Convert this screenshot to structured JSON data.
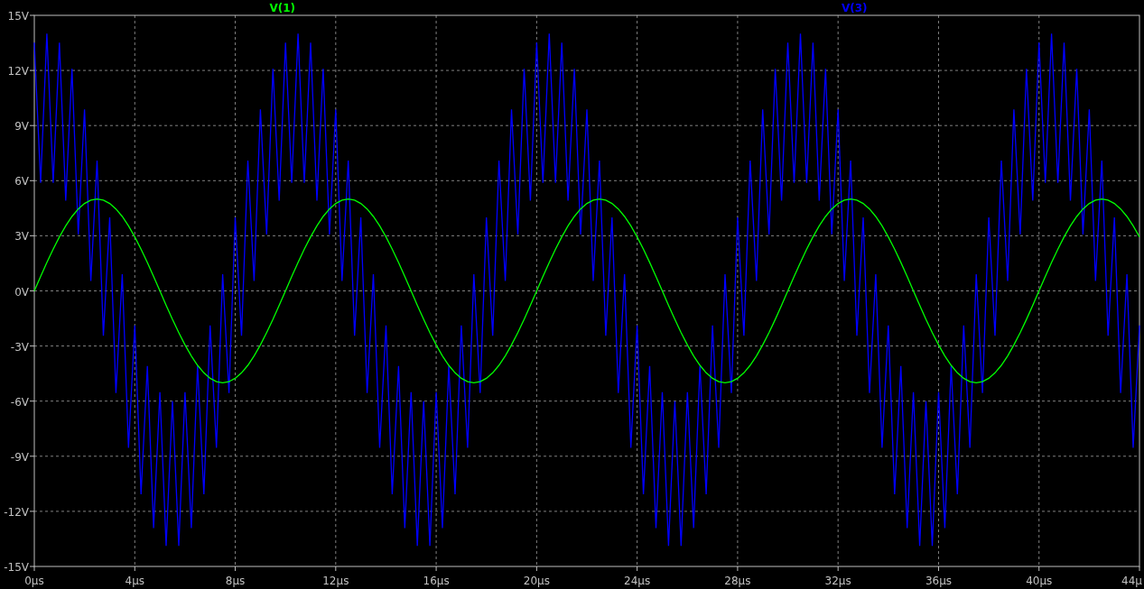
{
  "plot": {
    "chart_data": {
      "type": "line",
      "x": [
        0,
        0.25,
        0.5,
        0.75,
        1,
        1.25,
        1.5,
        1.75,
        2,
        2.25,
        2.5,
        2.75,
        3,
        3.25,
        3.5,
        3.75,
        4,
        4.25,
        4.5,
        4.75,
        5,
        5.25,
        5.5,
        5.75,
        6,
        6.25,
        6.5,
        6.75,
        7,
        7.25,
        7.5,
        7.75,
        8,
        8.25,
        8.5,
        8.75,
        9,
        9.25,
        9.5,
        9.75,
        10,
        10.25,
        10.5,
        10.75,
        11,
        11.25,
        11.5,
        11.75,
        12,
        12.25,
        12.5,
        12.75,
        13,
        13.25,
        13.5,
        13.75,
        14,
        14.25,
        14.5,
        14.75,
        15,
        15.25,
        15.5,
        15.75,
        16,
        16.25,
        16.5,
        16.75,
        17,
        17.25,
        17.5,
        17.75,
        18,
        18.25,
        18.5,
        18.75,
        19,
        19.25,
        19.5,
        19.75,
        20,
        20.25,
        20.5,
        20.75,
        21,
        21.25,
        21.5,
        21.75,
        22,
        22.25,
        22.5,
        22.75,
        23,
        23.25,
        23.5,
        23.75,
        24,
        24.25,
        24.5,
        24.75,
        25,
        25.25,
        25.5,
        25.75,
        26,
        26.25,
        26.5,
        26.75,
        27,
        27.25,
        27.5,
        27.75,
        28,
        28.25,
        28.5,
        28.75,
        29,
        29.25,
        29.5,
        29.75,
        30,
        30.25,
        30.5,
        30.75,
        31,
        31.25,
        31.5,
        31.75,
        32,
        32.25,
        32.5,
        32.75,
        33,
        33.25,
        33.5,
        33.75,
        34,
        34.25,
        34.5,
        34.75,
        35,
        35.25,
        35.5,
        35.75,
        36,
        36.25,
        36.5,
        36.75,
        37,
        37.25,
        37.5,
        37.75,
        38,
        38.25,
        38.5,
        38.75,
        39,
        39.25,
        39.5,
        39.75,
        40,
        40.25,
        40.5,
        40.75,
        41,
        41.25,
        41.5,
        41.75,
        42,
        42.25,
        42.5,
        42.75,
        43,
        43.25,
        43.5,
        43.75,
        44
      ],
      "series": [
        {
          "name": "V(1)",
          "color": "#00ff00",
          "values": [
            0,
            0.78,
            1.55,
            2.27,
            2.94,
            3.54,
            4.05,
            4.46,
            4.76,
            4.94,
            5,
            4.94,
            4.76,
            4.46,
            4.05,
            3.54,
            2.94,
            2.27,
            1.55,
            0.78,
            0,
            -0.78,
            -1.55,
            -2.27,
            -2.94,
            -3.54,
            -4.05,
            -4.46,
            -4.76,
            -4.94,
            -5,
            -4.94,
            -4.76,
            -4.46,
            -4.05,
            -3.54,
            -2.94,
            -2.27,
            -1.55,
            -0.78,
            0,
            0.78,
            1.55,
            2.27,
            2.94,
            3.54,
            4.05,
            4.46,
            4.76,
            4.94,
            5,
            4.94,
            4.76,
            4.46,
            4.05,
            3.54,
            2.94,
            2.27,
            1.55,
            0.78,
            0,
            -0.78,
            -1.55,
            -2.27,
            -2.94,
            -3.54,
            -4.05,
            -4.46,
            -4.76,
            -4.94,
            -5,
            -4.94,
            -4.76,
            -4.46,
            -4.05,
            -3.54,
            -2.94,
            -2.27,
            -1.55,
            -0.78,
            0,
            0.78,
            1.55,
            2.27,
            2.94,
            3.54,
            4.05,
            4.46,
            4.76,
            4.94,
            5,
            4.94,
            4.76,
            4.46,
            4.05,
            3.54,
            2.94,
            2.27,
            1.55,
            0.78,
            0,
            -0.78,
            -1.55,
            -2.27,
            -2.94,
            -3.54,
            -4.05,
            -4.46,
            -4.76,
            -4.94,
            -5,
            -4.94,
            -4.76,
            -4.46,
            -4.05,
            -3.54,
            -2.94,
            -2.27,
            -1.55,
            -0.78,
            0,
            0.78,
            1.55,
            2.27,
            2.94,
            3.54,
            4.05,
            4.46,
            4.76,
            4.94,
            5,
            4.94,
            4.76,
            4.46,
            4.05,
            3.54,
            2.94,
            2.27,
            1.55,
            0.78,
            0,
            -0.78,
            -1.55,
            -2.27,
            -2.94,
            -3.54,
            -4.05,
            -4.46,
            -4.76,
            -4.94,
            -5,
            -4.94,
            -4.76,
            -4.46,
            -4.05,
            -3.54,
            -2.94,
            -2.27,
            -1.55,
            -0.78,
            0,
            0.78,
            1.55,
            2.27,
            2.94,
            3.54,
            4.05,
            4.46,
            4.76,
            4.94,
            5,
            4.94,
            4.76,
            4.46,
            4.05,
            3.54,
            2.94
          ]
        },
        {
          "name": "V(3)",
          "color": "#0000ff",
          "values": [
            13.51,
            5.88,
            14,
            5.88,
            13.51,
            4.91,
            12.09,
            3.07,
            9.88,
            0.54,
            7.09,
            -2.44,
            4,
            -5.56,
            0.91,
            -8.54,
            -1.88,
            -11.07,
            -4.09,
            -12.91,
            -5.51,
            -13.88,
            -6,
            -13.88,
            -5.51,
            -12.91,
            -4.09,
            -11.07,
            -1.88,
            -8.54,
            0.91,
            -5.56,
            4,
            -2.44,
            7.09,
            0.54,
            9.88,
            3.07,
            12.09,
            4.91,
            13.51,
            5.88,
            14,
            5.88,
            13.51,
            4.91,
            12.09,
            3.07,
            9.88,
            0.54,
            7.09,
            -2.44,
            4,
            -5.56,
            0.91,
            -8.54,
            -1.88,
            -11.07,
            -4.09,
            -12.91,
            -5.51,
            -13.88,
            -6,
            -13.88,
            -5.51,
            -12.91,
            -4.09,
            -11.07,
            -1.88,
            -8.54,
            0.91,
            -5.56,
            4,
            -2.44,
            7.09,
            0.54,
            9.88,
            3.07,
            12.09,
            4.91,
            13.51,
            5.88,
            14,
            5.88,
            13.51,
            4.91,
            12.09,
            3.07,
            9.88,
            0.54,
            7.09,
            -2.44,
            4,
            -5.56,
            0.91,
            -8.54,
            -1.88,
            -11.07,
            -4.09,
            -12.91,
            -5.51,
            -13.88,
            -6,
            -13.88,
            -5.51,
            -12.91,
            -4.09,
            -11.07,
            -1.88,
            -8.54,
            0.91,
            -5.56,
            4,
            -2.44,
            7.09,
            0.54,
            9.88,
            3.07,
            12.09,
            4.91,
            13.51,
            5.88,
            14,
            5.88,
            13.51,
            4.91,
            12.09,
            3.07,
            9.88,
            0.54,
            7.09,
            -2.44,
            4,
            -5.56,
            0.91,
            -8.54,
            -1.88,
            -11.07,
            -4.09,
            -12.91,
            -5.51,
            -13.88,
            -6,
            -13.88,
            -5.51,
            -12.91,
            -4.09,
            -11.07,
            -1.88,
            -8.54,
            0.91,
            -5.56,
            4,
            -2.44,
            7.09,
            0.54,
            9.88,
            3.07,
            12.09,
            4.91,
            13.51,
            5.88,
            14,
            5.88,
            13.51,
            4.91,
            12.09,
            3.07,
            9.88,
            0.54,
            7.09,
            -2.44,
            4,
            -5.56,
            0.91,
            -8.54,
            -1.88
          ]
        }
      ],
      "xlim": [
        0,
        44
      ],
      "ylim": [
        -15,
        15
      ],
      "grid": true,
      "xticks": [
        {
          "value": 0,
          "label": "0µs"
        },
        {
          "value": 4,
          "label": "4µs"
        },
        {
          "value": 8,
          "label": "8µs"
        },
        {
          "value": 12,
          "label": "12µs"
        },
        {
          "value": 16,
          "label": "16µs"
        },
        {
          "value": 20,
          "label": "20µs"
        },
        {
          "value": 24,
          "label": "24µs"
        },
        {
          "value": 28,
          "label": "28µs"
        },
        {
          "value": 32,
          "label": "32µs"
        },
        {
          "value": 36,
          "label": "36µs"
        },
        {
          "value": 40,
          "label": "40µs"
        },
        {
          "value": 44,
          "label": "44µ"
        }
      ],
      "yticks": [
        {
          "value": 15,
          "label": "15V"
        },
        {
          "value": 12,
          "label": "12V"
        },
        {
          "value": 9,
          "label": "9V"
        },
        {
          "value": 6,
          "label": "6V"
        },
        {
          "value": 3,
          "label": "3V"
        },
        {
          "value": 0,
          "label": "0V"
        },
        {
          "value": -3,
          "label": "-3V"
        },
        {
          "value": -6,
          "label": "-6V"
        },
        {
          "value": -9,
          "label": "-9V"
        },
        {
          "value": -12,
          "label": "-12V"
        },
        {
          "value": -15,
          "label": "-15V"
        }
      ]
    }
  }
}
